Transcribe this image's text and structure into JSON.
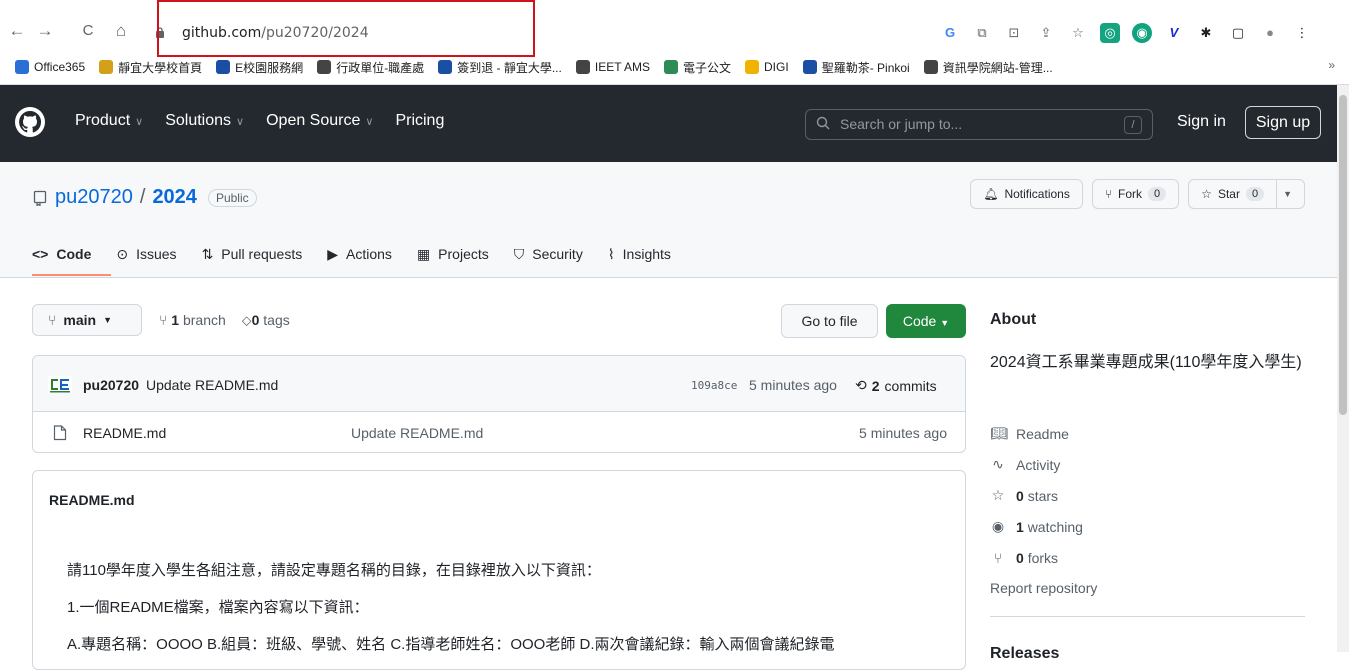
{
  "browser": {
    "url_host": "github.com",
    "url_path": "/pu20720/2024",
    "nav": {
      "back": "←",
      "forward": "→",
      "reload": "C",
      "home": "⌂"
    },
    "extensions": [
      "G",
      "⧉",
      "⊡",
      "⇪",
      "☆",
      "◎",
      "◉",
      "V",
      "✱",
      "▢",
      "●",
      "⋮"
    ],
    "bookmarks": [
      {
        "label": "Office365",
        "color": "#2a6fd6"
      },
      {
        "label": "靜宜大學校首頁",
        "color": "#d4a017"
      },
      {
        "label": "E校園服務網",
        "color": "#1b4fa3"
      },
      {
        "label": "行政單位-職產處",
        "color": "#444444"
      },
      {
        "label": "簽到退 - 靜宜大學...",
        "color": "#1b4fa3"
      },
      {
        "label": "IEET AMS",
        "color": "#444444"
      },
      {
        "label": "電子公文",
        "color": "#2e8b57"
      },
      {
        "label": "DIGI",
        "color": "#f0b400"
      },
      {
        "label": "聖羅勒茶- Pinkoi",
        "color": "#1b4fa3"
      },
      {
        "label": "資訊學院網站-管理...",
        "color": "#444444"
      }
    ],
    "bookmarks_more": "»"
  },
  "github": {
    "nav": [
      {
        "label": "Product",
        "caret": true
      },
      {
        "label": "Solutions",
        "caret": true
      },
      {
        "label": "Open Source",
        "caret": true
      },
      {
        "label": "Pricing",
        "caret": false
      }
    ],
    "search_placeholder": "Search or jump to...",
    "search_shortcut": "/",
    "sign_in": "Sign in",
    "sign_up": "Sign up"
  },
  "repo": {
    "owner": "pu20720",
    "separator": "/",
    "name": "2024",
    "visibility": "Public",
    "notifications": "Notifications",
    "fork_label": "Fork",
    "fork_count": "0",
    "star_label": "Star",
    "star_count": "0",
    "tabs": [
      {
        "label": "Code",
        "icon": "<>"
      },
      {
        "label": "Issues",
        "icon": "⊙"
      },
      {
        "label": "Pull requests",
        "icon": "⇅"
      },
      {
        "label": "Actions",
        "icon": "▶"
      },
      {
        "label": "Projects",
        "icon": "▦"
      },
      {
        "label": "Security",
        "icon": "⛉"
      },
      {
        "label": "Insights",
        "icon": "⌇"
      }
    ]
  },
  "code": {
    "branch": "main",
    "branch_count": "1",
    "branch_word": "branch",
    "tag_count": "0",
    "tag_word": "tags",
    "goto_file": "Go to file",
    "code_button": "Code",
    "commit": {
      "author": "pu20720",
      "message": "Update README.md",
      "sha": "109a8ce",
      "ago": "5 minutes ago",
      "commit_count": "2",
      "commit_word": "commits"
    },
    "files": [
      {
        "name": "README.md",
        "message": "Update README.md",
        "ago": "5 minutes ago"
      }
    ],
    "readme_title": "README.md",
    "readme_lines": [
      "請110學年度入學生各組注意，請設定專題名稱的目錄，在目錄裡放入以下資訊：",
      "1.一個README檔案，檔案內容寫以下資訊：",
      "A.專題名稱：OOOO B.組員：班級、學號、姓名 C.指導老師姓名：OOO老師 D.兩次會議紀錄：輸入兩個會議紀錄電"
    ]
  },
  "about": {
    "title": "About",
    "description": "2024資工系畢業專題成果(110學年度入學生)",
    "readme": "Readme",
    "activity": "Activity",
    "stars_count": "0",
    "stars_word": "stars",
    "watching_count": "1",
    "watching_word": "watching",
    "forks_count": "0",
    "forks_word": "forks",
    "report": "Report repository",
    "releases_title": "Releases"
  }
}
